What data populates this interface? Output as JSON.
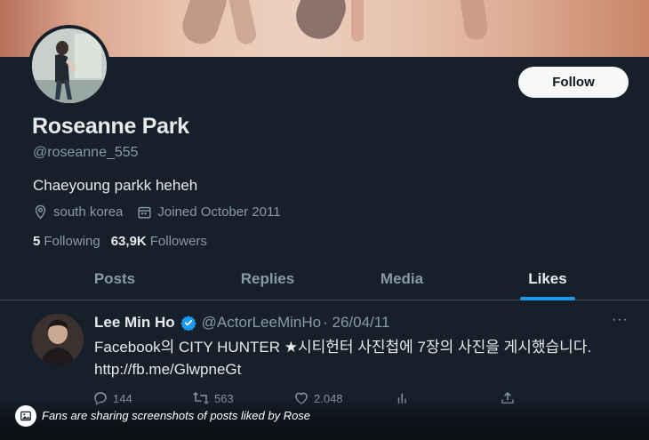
{
  "profile": {
    "name": "Roseanne Park",
    "handle": "@roseanne_555",
    "bio": "Chaeyoung parkk heheh",
    "location": "south korea",
    "joined": "Joined October 2011",
    "following_count": "5",
    "following_label": "Following",
    "followers_count": "63,9K",
    "followers_label": "Followers",
    "follow_button": "Follow"
  },
  "tabs": [
    {
      "label": "Posts",
      "active": false
    },
    {
      "label": "Replies",
      "active": false
    },
    {
      "label": "Media",
      "active": false
    },
    {
      "label": "Likes",
      "active": true
    }
  ],
  "tweet": {
    "author": "Lee Min Ho",
    "username": "@ActorLeeMinHo",
    "date": "· 26/04/11",
    "more": "···",
    "text_line1": "Facebook의 CITY HUNTER ★시티헌터 사진첩에 7장의 사진을 게시했습니다.",
    "text_line2": "http://fb.me/GlwpneGt",
    "replies": "144",
    "retweets": "563",
    "likes": "2.048"
  },
  "caption": {
    "text": "Fans are sharing screenshots of posts liked by Rose"
  },
  "colors": {
    "background": "#15202b",
    "accent": "#1d9bf0",
    "text_primary": "#e7e9ea",
    "text_secondary": "#8b98a5"
  },
  "icons": [
    "location-icon",
    "calendar-icon",
    "verified-icon",
    "reply-icon",
    "retweet-icon",
    "like-icon",
    "views-icon",
    "share-icon",
    "image-icon"
  ]
}
